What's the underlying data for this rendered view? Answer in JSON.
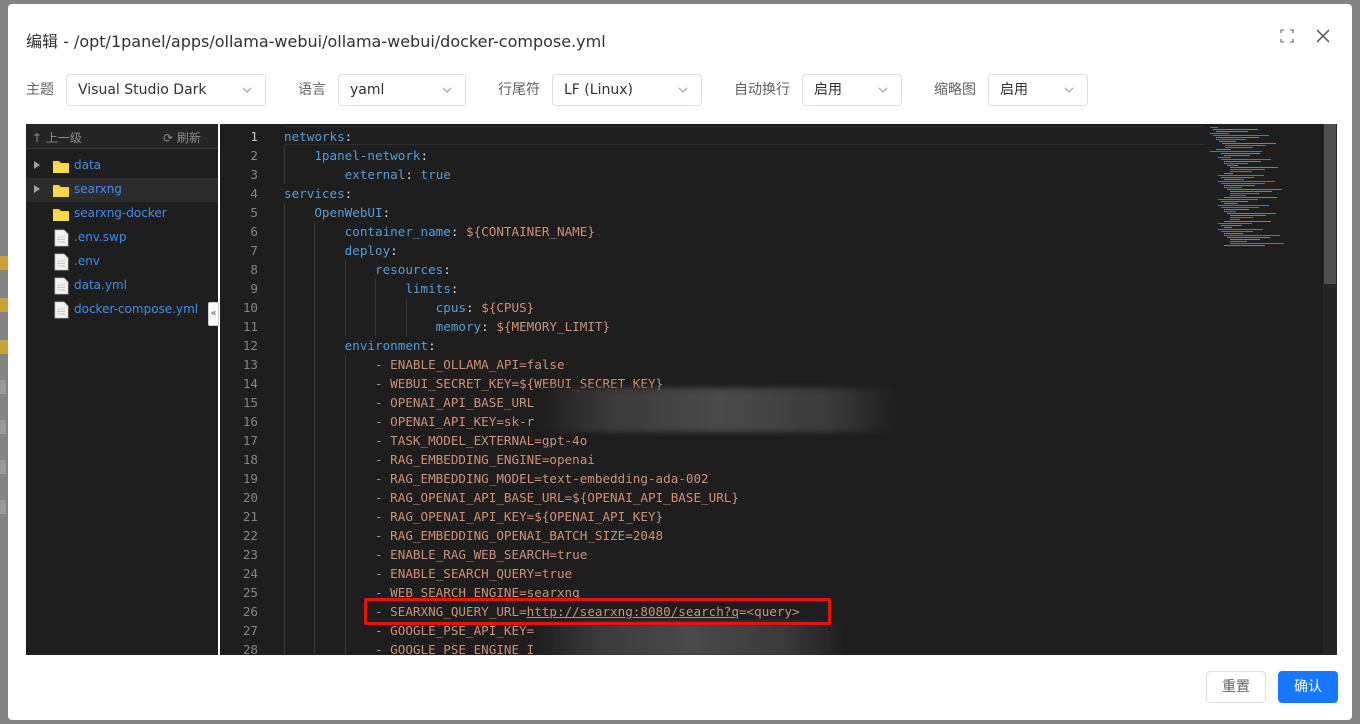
{
  "dialog": {
    "title": "编辑 - /opt/1panel/apps/ollama-webui/ollama-webui/docker-compose.yml",
    "icons": [
      "fullscreen-icon",
      "close-icon"
    ]
  },
  "toolbar": {
    "theme_label": "主题",
    "theme_value": "Visual Studio Dark",
    "language_label": "语言",
    "language_value": "yaml",
    "eol_label": "行尾符",
    "eol_value": "LF (Linux)",
    "wrap_label": "自动换行",
    "wrap_value": "启用",
    "minimap_label": "缩略图",
    "minimap_value": "启用"
  },
  "tree": {
    "up_label": "上一级",
    "refresh_label": "刷新",
    "items": [
      {
        "name": "data",
        "type": "folder",
        "expandable": true
      },
      {
        "name": "searxng",
        "type": "folder",
        "expandable": true,
        "selected": true
      },
      {
        "name": "searxng-docker",
        "type": "folder",
        "expandable": false
      },
      {
        "name": ".env.swp",
        "type": "file"
      },
      {
        "name": ".env",
        "type": "file"
      },
      {
        "name": "data.yml",
        "type": "file"
      },
      {
        "name": "docker-compose.yml",
        "type": "file"
      }
    ],
    "collapse_glyph": "«"
  },
  "editor": {
    "lines": [
      {
        "n": "1",
        "text": "networks:"
      },
      {
        "n": "2",
        "text": "    1panel-network:"
      },
      {
        "n": "3",
        "text": "        external: true"
      },
      {
        "n": "4",
        "text": "services:"
      },
      {
        "n": "5",
        "text": "    OpenWebUI:"
      },
      {
        "n": "6",
        "text": "        container_name: ${CONTAINER_NAME}"
      },
      {
        "n": "7",
        "text": "        deploy:"
      },
      {
        "n": "8",
        "text": "            resources:"
      },
      {
        "n": "9",
        "text": "                limits:"
      },
      {
        "n": "10",
        "text": "                    cpus: ${CPUS}"
      },
      {
        "n": "11",
        "text": "                    memory: ${MEMORY_LIMIT}"
      },
      {
        "n": "12",
        "text": "        environment:"
      },
      {
        "n": "13",
        "text": "            - ENABLE_OLLAMA_API=false"
      },
      {
        "n": "14",
        "text": "            - WEBUI_SECRET_KEY=${WEBUI_SECRET_KEY}"
      },
      {
        "n": "15",
        "text": "            - OPENAI_API_BASE_URL"
      },
      {
        "n": "16",
        "text": "            - OPENAI_API_KEY=sk-r"
      },
      {
        "n": "17",
        "text": "            - TASK_MODEL_EXTERNAL=gpt-4o"
      },
      {
        "n": "18",
        "text": "            - RAG_EMBEDDING_ENGINE=openai"
      },
      {
        "n": "19",
        "text": "            - RAG_EMBEDDING_MODEL=text-embedding-ada-002"
      },
      {
        "n": "20",
        "text": "            - RAG_OPENAI_API_BASE_URL=${OPENAI_API_BASE_URL}"
      },
      {
        "n": "21",
        "text": "            - RAG_OPENAI_API_KEY=${OPENAI_API_KEY}"
      },
      {
        "n": "22",
        "text": "            - RAG_EMBEDDING_OPENAI_BATCH_SIZE=2048"
      },
      {
        "n": "23",
        "text": "            - ENABLE_RAG_WEB_SEARCH=true"
      },
      {
        "n": "24",
        "text": "            - ENABLE_SEARCH_QUERY=true"
      },
      {
        "n": "25",
        "text": "            - WEB_SEARCH_ENGINE=searxng"
      },
      {
        "n": "26",
        "text": "            - SEARXNG_QUERY_URL=http://searxng:8080/search?q=<query>"
      },
      {
        "n": "27",
        "text": "            - GOOGLE_PSE_API_KEY="
      },
      {
        "n": "28",
        "text": "            - GOOGLE_PSE_ENGINE_I"
      }
    ]
  },
  "footer": {
    "reset_label": "重置",
    "confirm_label": "确认"
  },
  "colors": {
    "editor_bg": "#1e1e1e",
    "key": "#569cd6",
    "string": "#ce9178",
    "link": "#3b8ef2",
    "primary": "#1677ff",
    "highlight_box": "#e8120c"
  }
}
